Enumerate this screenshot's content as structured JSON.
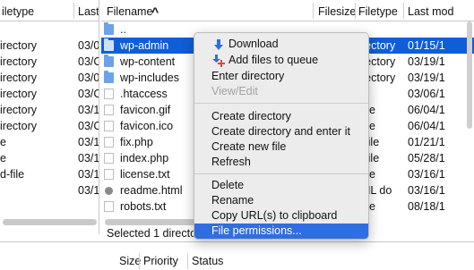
{
  "left_pane": {
    "headers": {
      "filetype": "iletype",
      "lastmod": "Last"
    },
    "rows": [
      {
        "type": "",
        "date": ""
      },
      {
        "type": "irectory",
        "date": "03/0"
      },
      {
        "type": "irectory",
        "date": "03/C"
      },
      {
        "type": "irectory",
        "date": "03/0"
      },
      {
        "type": "irectory",
        "date": "03/C"
      },
      {
        "type": "irectory",
        "date": "03/1"
      },
      {
        "type": "irectory",
        "date": "03/C"
      },
      {
        "type": "e",
        "date": "03/1"
      },
      {
        "type": "e",
        "date": "03/1"
      },
      {
        "type": "d-file",
        "date": "03/1"
      },
      {
        "type": "",
        "date": "03/1"
      }
    ]
  },
  "right_pane": {
    "headers": {
      "filename": "Filename",
      "sort_indicator": "^",
      "filesize": "Filesize",
      "filetype": "Filetype",
      "lastmod": "Last mod"
    },
    "rows": [
      {
        "name": "..",
        "icon": "folder-icon",
        "type": "",
        "date": ""
      },
      {
        "name": "wp-admin",
        "icon": "folder-icon",
        "type": "rectory",
        "date": "01/15/1",
        "selected": true
      },
      {
        "name": "wp-content",
        "icon": "folder-icon",
        "type": "rectory",
        "date": "03/19/1"
      },
      {
        "name": "wp-includes",
        "icon": "folder-icon",
        "type": "rectory",
        "date": "03/19/1"
      },
      {
        "name": ".htaccess",
        "icon": "file-icon",
        "type": "",
        "date": "03/06/1"
      },
      {
        "name": "favicon.gif",
        "icon": "file-icon",
        "type": "file",
        "date": "06/04/1"
      },
      {
        "name": "favicon.ico",
        "icon": "file-icon",
        "type": "file",
        "date": "06/04/1"
      },
      {
        "name": "fix.php",
        "icon": "file-icon",
        "type": "-file",
        "date": "01/21/1"
      },
      {
        "name": "index.php",
        "icon": "file-icon",
        "type": "-file",
        "date": "05/28/1"
      },
      {
        "name": "license.txt",
        "icon": "file-icon",
        "type": "file",
        "date": "03/16/1"
      },
      {
        "name": "readme.html",
        "icon": "globe-icon",
        "type": "ML do",
        "date": "03/16/1"
      },
      {
        "name": "robots.txt",
        "icon": "file-icon",
        "type": "file",
        "date": "08/18/1"
      }
    ],
    "status": "Selected 1 directory"
  },
  "queue": {
    "size": "Size",
    "priority": "Priority",
    "status": "Status"
  },
  "context_menu": {
    "download": "Download",
    "add_to_queue": "Add files to queue",
    "enter_directory": "Enter directory",
    "view_edit": "View/Edit",
    "create_directory": "Create directory",
    "create_directory_enter": "Create directory and enter it",
    "create_file": "Create new file",
    "refresh": "Refresh",
    "delete": "Delete",
    "rename": "Rename",
    "copy_url": "Copy URL(s) to clipboard",
    "file_permissions": "File permissions..."
  },
  "colors": {
    "selection": "#0f5ed8",
    "menu_highlight": "#2f6ee0",
    "folder": "#6aa3e8"
  }
}
